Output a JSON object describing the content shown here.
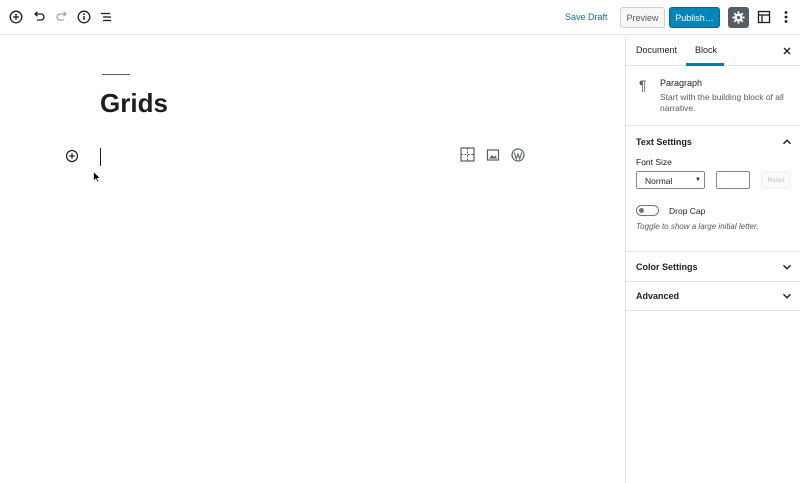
{
  "toolbar": {
    "save_draft": "Save Draft",
    "preview": "Preview",
    "publish": "Publish…",
    "icons": [
      "add-block-icon",
      "undo-icon",
      "redo-icon",
      "info-icon",
      "outline-icon",
      "gear-icon",
      "block-navigation-icon",
      "more-vertical-icon"
    ]
  },
  "editor": {
    "title": "Grids",
    "quick_inserter_icons": [
      "grid-block-icon",
      "image-icon",
      "wordpress-icon"
    ]
  },
  "sidebar": {
    "tabs": [
      {
        "label": "Document",
        "active": false
      },
      {
        "label": "Block",
        "active": true
      }
    ],
    "block_card": {
      "icon": "paragraph-icon",
      "name": "Paragraph",
      "description": "Start with the building block of all narrative."
    },
    "text_settings": {
      "title": "Text Settings",
      "expanded": true,
      "font_size_label": "Font Size",
      "font_size_value": "Normal",
      "custom_size_value": "",
      "reset_label": "Reset",
      "drop_cap_label": "Drop Cap",
      "drop_cap_enabled": false,
      "drop_cap_help": "Toggle to show a large initial letter."
    },
    "color_settings": {
      "title": "Color Settings",
      "expanded": false
    },
    "advanced": {
      "title": "Advanced",
      "expanded": false
    }
  },
  "colors": {
    "accent": "#0085ba",
    "link": "#0073aa",
    "tab_active": "#007cba",
    "settings_bg": "#555d66"
  }
}
